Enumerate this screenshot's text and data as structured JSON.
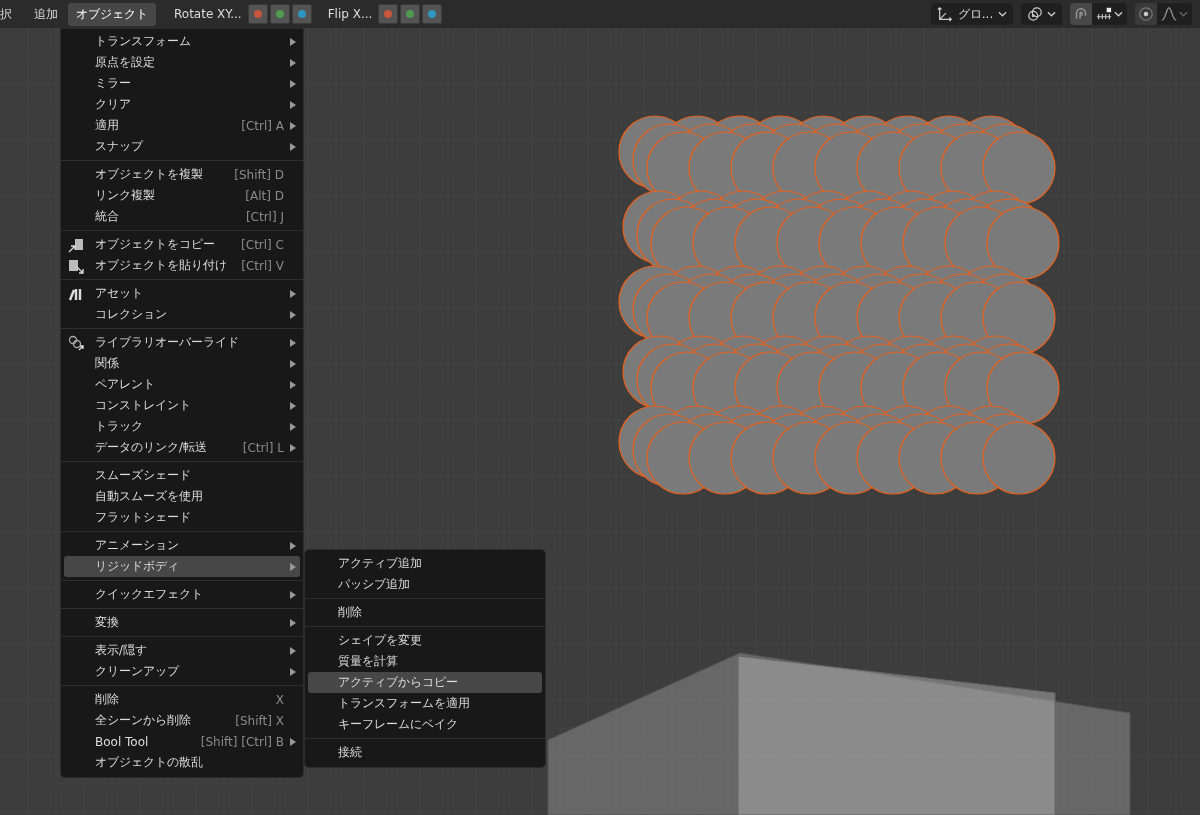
{
  "header": {
    "menus": [
      {
        "label": "択",
        "selected": false
      },
      {
        "label": "追加",
        "selected": false
      },
      {
        "label": "オブジェクト",
        "selected": true
      }
    ],
    "axis_groups": [
      {
        "label": "Rotate XY...",
        "buttons": [
          {
            "color": "#c8553d"
          },
          {
            "color": "#4e9a4e"
          },
          {
            "color": "#2f95c0"
          }
        ]
      },
      {
        "label": "Flip X...",
        "buttons": [
          {
            "color": "#c8553d"
          },
          {
            "color": "#4e9a4e"
          },
          {
            "color": "#2f95c0"
          }
        ]
      }
    ],
    "orientation": {
      "value": "グロ..."
    }
  },
  "object_menu": {
    "sections": [
      [
        {
          "label": "トランスフォーム",
          "submenu": true,
          "selected": false
        },
        {
          "label": "原点を設定",
          "submenu": true,
          "selected": false
        },
        {
          "label": "ミラー",
          "submenu": true,
          "selected": false
        },
        {
          "label": "クリア",
          "submenu": true,
          "selected": false
        },
        {
          "label": "適用",
          "shortcut": "[Ctrl] A",
          "submenu": true,
          "selected": false
        },
        {
          "label": "スナップ",
          "submenu": true,
          "selected": false
        }
      ],
      [
        {
          "label": "オブジェクトを複製",
          "shortcut": "[Shift] D",
          "submenu": false,
          "selected": false
        },
        {
          "label": "リンク複製",
          "shortcut": "[Alt] D",
          "submenu": false,
          "selected": false
        },
        {
          "label": "統合",
          "shortcut": "[Ctrl] J",
          "submenu": false,
          "selected": false
        }
      ],
      [
        {
          "label": "オブジェクトをコピー",
          "shortcut": "[Ctrl] C",
          "kind": "copy",
          "submenu": false,
          "selected": false
        },
        {
          "label": "オブジェクトを貼り付け",
          "shortcut": "[Ctrl] V",
          "kind": "paste",
          "submenu": false,
          "selected": false
        }
      ],
      [
        {
          "label": "アセット",
          "kind": "asset",
          "submenu": true,
          "selected": false
        },
        {
          "label": "コレクション",
          "submenu": true,
          "selected": false
        }
      ],
      [
        {
          "label": "ライブラリオーバーライド",
          "kind": "override",
          "submenu": true,
          "selected": false
        },
        {
          "label": "関係",
          "submenu": true,
          "selected": false
        },
        {
          "label": "ペアレント",
          "submenu": true,
          "selected": false
        },
        {
          "label": "コンストレイント",
          "submenu": true,
          "selected": false
        },
        {
          "label": "トラック",
          "submenu": true,
          "selected": false
        },
        {
          "label": "データのリンク/転送",
          "shortcut": "[Ctrl] L",
          "submenu": true,
          "selected": false
        }
      ],
      [
        {
          "label": "スムーズシェード",
          "submenu": false,
          "selected": false
        },
        {
          "label": "自動スムーズを使用",
          "submenu": false,
          "selected": false
        },
        {
          "label": "フラットシェード",
          "submenu": false,
          "selected": false
        }
      ],
      [
        {
          "label": "アニメーション",
          "submenu": true,
          "selected": false
        },
        {
          "label": "リジッドボディ",
          "submenu": true,
          "selected": true
        }
      ],
      [
        {
          "label": "クイックエフェクト",
          "submenu": true,
          "selected": false
        }
      ],
      [
        {
          "label": "変換",
          "submenu": true,
          "selected": false
        }
      ],
      [
        {
          "label": "表示/隠す",
          "submenu": true,
          "selected": false
        },
        {
          "label": "クリーンアップ",
          "submenu": true,
          "selected": false
        }
      ],
      [
        {
          "label": "削除",
          "shortcut": "X",
          "submenu": false,
          "selected": false
        },
        {
          "label": "全シーンから削除",
          "shortcut": "[Shift] X",
          "submenu": false,
          "selected": false
        },
        {
          "label": "Bool Tool",
          "shortcut": "[Shift] [Ctrl] B",
          "submenu": true,
          "selected": false
        },
        {
          "label": "オブジェクトの散乱",
          "submenu": false,
          "selected": false
        }
      ]
    ]
  },
  "rigid_body_submenu": {
    "sections": [
      [
        {
          "label": "アクティブ追加",
          "selected": false
        },
        {
          "label": "パッシブ追加",
          "selected": false
        }
      ],
      [
        {
          "label": "削除",
          "selected": false
        }
      ],
      [
        {
          "label": "シェイプを変更",
          "selected": false
        },
        {
          "label": "質量を計算",
          "selected": false
        },
        {
          "label": "アクティブからコピー",
          "selected": true
        },
        {
          "label": "トランスフォームを適用",
          "selected": false
        },
        {
          "label": "キーフレームにベイク",
          "selected": false
        }
      ],
      [
        {
          "label": "接続",
          "selected": false
        }
      ]
    ]
  }
}
